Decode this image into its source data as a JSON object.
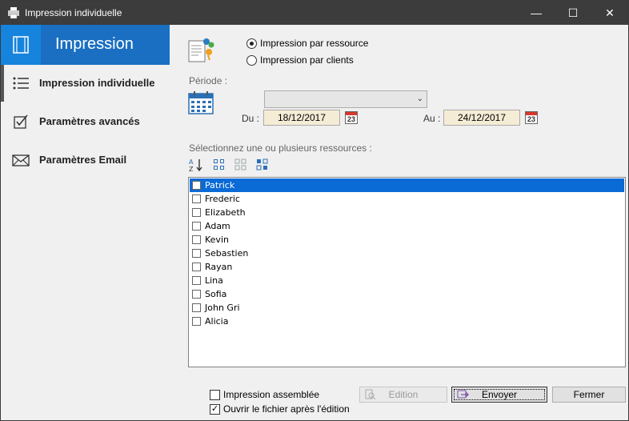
{
  "window": {
    "title": "Impression individuelle",
    "controls": {
      "minimize": "—",
      "maximize": "☐",
      "close": "✕"
    }
  },
  "sidebar": {
    "header": "Impression",
    "items": [
      {
        "label": "Impression individuelle",
        "icon": "list-icon",
        "active": true
      },
      {
        "label": "Paramètres avancés",
        "icon": "checkbox-icon",
        "active": false
      },
      {
        "label": "Paramètres Email",
        "icon": "envelope-icon",
        "active": false
      }
    ]
  },
  "mode": {
    "option_resource": "Impression par ressource",
    "option_clients": "Impression par clients",
    "selected": "resource"
  },
  "periode": {
    "label": "Période :",
    "combo_value": "",
    "du_label": "Du :",
    "du_value": "18/12/2017",
    "au_label": "Au :",
    "au_value": "24/12/2017",
    "calendar_day": "23"
  },
  "resources": {
    "label": "Sélectionnez une ou plusieurs ressources :",
    "items": [
      {
        "name": "Patrick",
        "selected": true,
        "checked": false
      },
      {
        "name": "Frederic",
        "selected": false,
        "checked": false
      },
      {
        "name": "Elizabeth",
        "selected": false,
        "checked": false
      },
      {
        "name": "Adam",
        "selected": false,
        "checked": false
      },
      {
        "name": "Kevin",
        "selected": false,
        "checked": false
      },
      {
        "name": "Sebastien",
        "selected": false,
        "checked": false
      },
      {
        "name": "Rayan",
        "selected": false,
        "checked": false
      },
      {
        "name": "Lina",
        "selected": false,
        "checked": false
      },
      {
        "name": "Sofia",
        "selected": false,
        "checked": false
      },
      {
        "name": "John Gri",
        "selected": false,
        "checked": false
      },
      {
        "name": "Alicia",
        "selected": false,
        "checked": false
      }
    ]
  },
  "options": {
    "assembled_label": "Impression assemblée",
    "assembled_checked": false,
    "open_file_label": "Ouvrir le fichier après l'édition",
    "open_file_checked": true
  },
  "buttons": {
    "edition": "Edition",
    "envoyer": "Envoyer",
    "fermer": "Fermer"
  },
  "colors": {
    "accent": "#1a6fc2",
    "accent_light": "#1683dd",
    "selection": "#0a6ad6",
    "titlebar": "#3c3c3c"
  }
}
